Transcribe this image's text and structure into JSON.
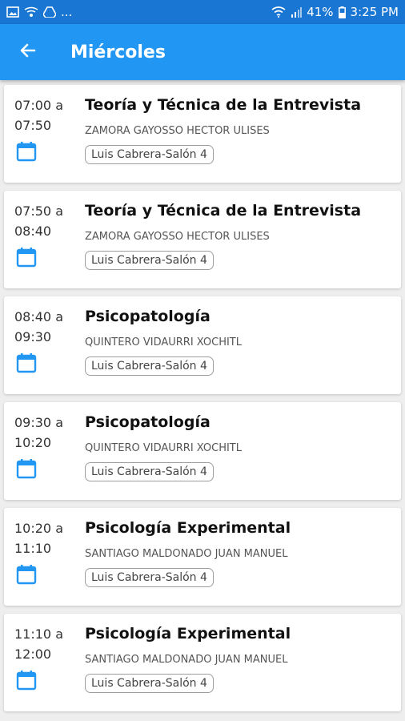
{
  "status_bar": {
    "left_icons": [
      "image-icon",
      "cast-icon",
      "drive-icon"
    ],
    "ellipsis": "...",
    "battery": "41%",
    "time": "3:25 PM"
  },
  "app_bar": {
    "title": "Miércoles",
    "back_icon": "arrow-left-icon"
  },
  "colors": {
    "status_bar": "#1976d2",
    "app_bar": "#2196f3",
    "calendar_icon": "#2196f3",
    "background": "#eeeeee"
  },
  "classes": [
    {
      "start": "07:00 a",
      "end": "07:50",
      "subject": "Teoría y Técnica de la Entrevista",
      "teacher": "ZAMORA GAYOSSO HECTOR ULISES",
      "room": "Luis Cabrera-Salón 4"
    },
    {
      "start": "07:50 a",
      "end": "08:40",
      "subject": "Teoría y Técnica de la Entrevista",
      "teacher": "ZAMORA GAYOSSO HECTOR ULISES",
      "room": "Luis Cabrera-Salón 4"
    },
    {
      "start": "08:40 a",
      "end": "09:30",
      "subject": "Psicopatología",
      "teacher": "QUINTERO VIDAURRI XOCHITL",
      "room": "Luis Cabrera-Salón 4"
    },
    {
      "start": "09:30 a",
      "end": "10:20",
      "subject": "Psicopatología",
      "teacher": "QUINTERO VIDAURRI XOCHITL",
      "room": "Luis Cabrera-Salón 4"
    },
    {
      "start": "10:20 a",
      "end": "11:10",
      "subject": "Psicología Experimental",
      "teacher": "SANTIAGO MALDONADO JUAN MANUEL",
      "room": "Luis Cabrera-Salón 4"
    },
    {
      "start": "11:10 a",
      "end": "12:00",
      "subject": "Psicología Experimental",
      "teacher": "SANTIAGO MALDONADO JUAN MANUEL",
      "room": "Luis Cabrera-Salón 4"
    }
  ]
}
